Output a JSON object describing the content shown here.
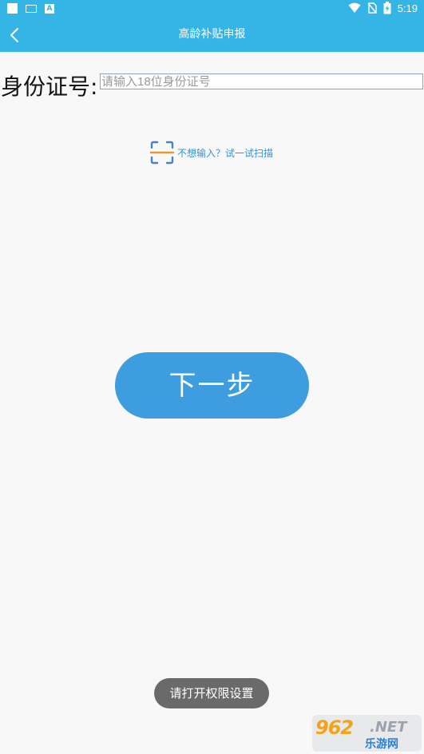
{
  "status_bar": {
    "time": "5:19",
    "left_icons": [
      "square-notification-icon",
      "keyboard-icon",
      "a-notification-icon"
    ],
    "right_icons": [
      "wifi-icon",
      "no-sim-icon",
      "battery-charging-icon"
    ]
  },
  "app_bar": {
    "title": "高龄补贴申报",
    "back_icon": "back-chevron-icon"
  },
  "form": {
    "id_label": "身份证号:",
    "id_placeholder": "请输入18位身份证号",
    "id_value": ""
  },
  "scan": {
    "icon": "scan-icon",
    "text": "不想输入？试一试扫描"
  },
  "next_button": {
    "label": "下一步"
  },
  "toast": {
    "text": "请打开权限设置"
  },
  "watermark": {
    "number": "962",
    "suffix": ".NET",
    "subtitle": "乐游网"
  },
  "colors": {
    "primary": "#35b5e6",
    "button": "#3d9dde",
    "scan_accent": "#e69a2e",
    "scan_frame": "#4a84c0",
    "toast_bg": "#6a6a6a"
  }
}
